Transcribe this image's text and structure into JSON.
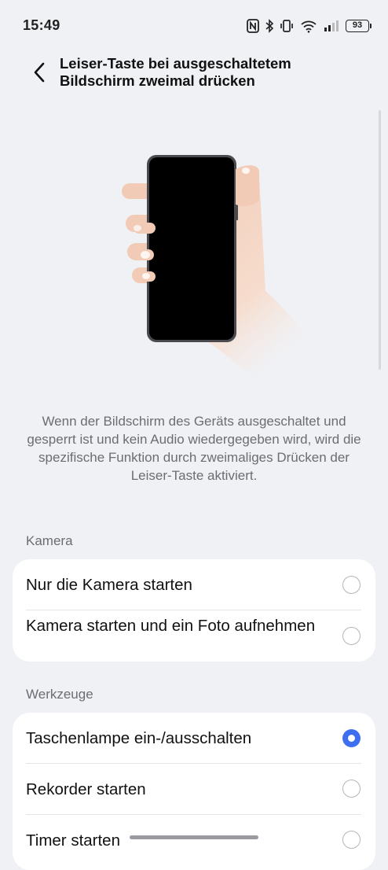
{
  "status_bar": {
    "time": "15:49",
    "battery": "93",
    "icons": [
      "nfc-icon",
      "bluetooth-icon",
      "vibrate-icon",
      "wifi-icon",
      "signal-icon",
      "battery-icon"
    ]
  },
  "header": {
    "title": "Leiser-Taste bei ausgeschaltetem Bildschirm zweimal drücken",
    "back_icon": "chevron-left-icon"
  },
  "description": "Wenn der Bildschirm des Geräts ausgeschaltet und gesperrt ist und kein Audio wiedergegeben wird, wird die spezifische Funktion durch zweimaliges Drücken der Leiser-Taste aktiviert.",
  "sections": [
    {
      "label": "Kamera",
      "options": [
        {
          "label": "Nur die Kamera starten",
          "selected": false
        },
        {
          "label": "Kamera starten und ein Foto aufnehmen",
          "selected": false
        }
      ]
    },
    {
      "label": "Werkzeuge",
      "options": [
        {
          "label": "Taschenlampe ein-/ausschalten",
          "selected": true
        },
        {
          "label": "Rekorder starten",
          "selected": false
        },
        {
          "label": "Timer starten",
          "selected": false
        }
      ]
    }
  ],
  "colors": {
    "background": "#f0f1f5",
    "card": "#ffffff",
    "accent": "#3e6ff0",
    "secondary_text": "#6b6d73"
  }
}
